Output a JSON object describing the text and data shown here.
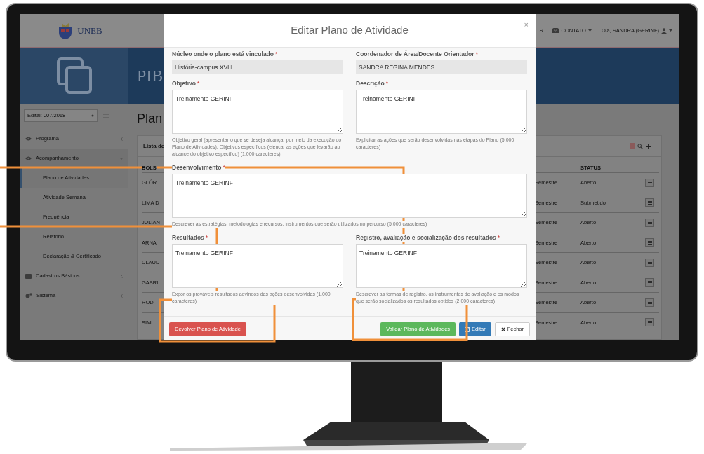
{
  "header": {
    "logo_text": "UNEB",
    "nav": [
      {
        "label": "S",
        "kind": "text"
      },
      {
        "label": "CONTATO",
        "kind": "mail"
      },
      {
        "label": "Olá, SANDRA (GERINF)",
        "kind": "user"
      }
    ]
  },
  "banner": {
    "title": "PIB"
  },
  "sidebar": {
    "edital": "Edital: 007/2018",
    "items": [
      {
        "label": "Programa",
        "kind": "eye",
        "expanded": false
      },
      {
        "label": "Acompanhamento",
        "kind": "eye",
        "expanded": true,
        "children": [
          {
            "label": "Plano de Atividades",
            "selected": true
          },
          {
            "label": "Atividade Semanal",
            "selected": false
          },
          {
            "label": "Frequência",
            "selected": false
          },
          {
            "label": "Relatório",
            "selected": false
          },
          {
            "label": "Declaração & Certificado",
            "selected": false
          }
        ]
      },
      {
        "label": "Cadastros Básicos",
        "kind": "inbox",
        "expanded": false
      },
      {
        "label": "Sistema",
        "kind": "gears",
        "expanded": false
      }
    ]
  },
  "main": {
    "title": "Plan",
    "card_title": "Lista de",
    "table": {
      "columns": [
        "BOLS",
        "STATUS"
      ],
      "rows": [
        {
          "name": "GLÓR",
          "period": "Semestre",
          "status": "Aberto"
        },
        {
          "name": "LIMA D",
          "period": "Semestre",
          "status": "Submetido"
        },
        {
          "name": "JULIAN",
          "period": "Semestre",
          "status": "Aberto"
        },
        {
          "name": "ARNA",
          "period": "Semestre",
          "status": "Aberto"
        },
        {
          "name": "CLAUD",
          "period": "Semestre",
          "status": "Aberto"
        },
        {
          "name": "GABRI",
          "period": "Semestre",
          "status": "Aberto"
        },
        {
          "name": "ROD",
          "period": "Semestre",
          "status": "Aberto"
        },
        {
          "name": "SIMI",
          "period": "Semestre",
          "status": "Aberto"
        }
      ]
    }
  },
  "modal": {
    "title": "Editar Plano de Atividade",
    "close": "×",
    "fields": [
      {
        "label": "Núcleo onde o plano está vinculado",
        "required_mark": "*",
        "kind": "input",
        "value": "História-campus XVIII"
      },
      {
        "label": "Coordenador de Área/Docente Orientador",
        "required_mark": "*",
        "kind": "input",
        "value": "SANDRA REGINA MENDES"
      },
      {
        "label": "Objetivo",
        "required_mark": "*",
        "kind": "textarea",
        "value": "Treinamento GERINF",
        "help": "Objetivo geral (apresentar o que se deseja alcançar por meio da execução do Plano de Atividades). Objetivos específicos (elencar as ações que levarão ao alcance do objetivo específico) (1.000 caracteres)"
      },
      {
        "label": "Descrição",
        "required_mark": "*",
        "kind": "textarea",
        "value": "Treinamento GERINF",
        "help": "Explicitar as ações que serão desenvolvidas nas etapas do Plano (5.000 caracteres)"
      },
      {
        "label": "Desenvolvimento",
        "required_mark": "*",
        "kind": "wide_textarea",
        "value": "Treinamento GERINF",
        "help": "Descrever as estratégias, metodologias e recursos, instrumentos que serão utilizados no percurso (5.000 caracteres)"
      },
      {
        "label": "Resultados",
        "required_mark": "*",
        "kind": "textarea",
        "value": "Treinamento GERINF",
        "help": "Expor os prováveis resultados advindos das ações desenvolvidas (1.000 caracteres)"
      },
      {
        "label": "Registro, avaliação e socialização dos resultados",
        "required_mark": "*",
        "kind": "textarea",
        "value": "Treinamento GERINF",
        "help": "Descrever as formas de registro, os instrumentos de avaliação e os modos que serão socializados os resultados obtidos (2.000 caracteres)"
      }
    ],
    "buttons": [
      {
        "label": "Devolver Plano de Atividade",
        "kind": "danger"
      },
      {
        "label": "Validar Plano de Atividades",
        "kind": "success"
      },
      {
        "label": "Editar",
        "kind": "primary"
      },
      {
        "label": "Fechar",
        "kind": "default"
      }
    ]
  }
}
